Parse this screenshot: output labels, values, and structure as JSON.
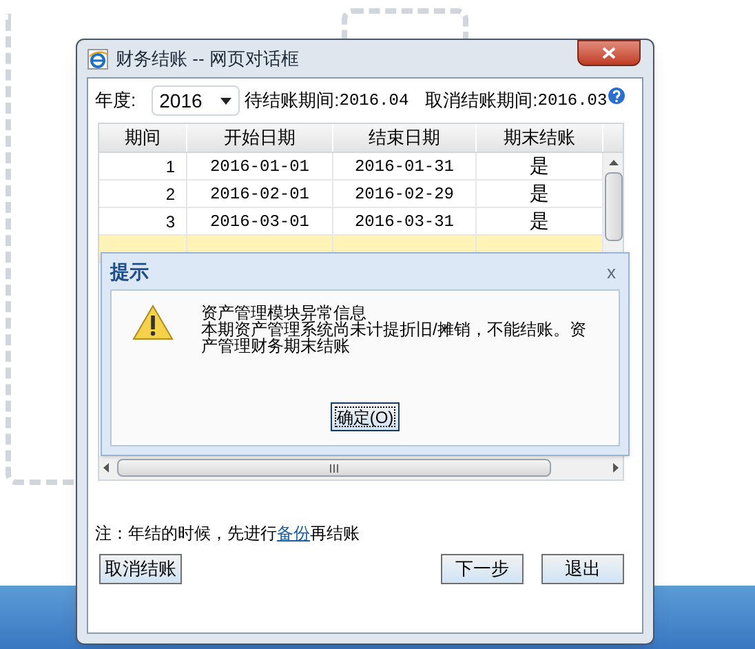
{
  "window": {
    "title": "财务结账 -- 网页对话框"
  },
  "filter": {
    "year_label": "年度:",
    "year": "2016",
    "pending_label": "待结账期间:",
    "pending": "2016.04",
    "cancel_label": "取消结账期间:",
    "cancel": "2016.03"
  },
  "table": {
    "columns": [
      "期间",
      "开始日期",
      "结束日期",
      "期末结账"
    ],
    "rows": [
      {
        "cells": [
          "1",
          "2016-01-01",
          "2016-01-31",
          "是"
        ],
        "selected": false
      },
      {
        "cells": [
          "2",
          "2016-02-01",
          "2016-02-29",
          "是"
        ],
        "selected": false
      },
      {
        "cells": [
          "3",
          "2016-03-01",
          "2016-03-31",
          "是"
        ],
        "selected": false
      },
      {
        "selected": true
      }
    ]
  },
  "note": {
    "before": "注：年结的时候，先进行",
    "link": "备份",
    "after": "再结账"
  },
  "buttons": [
    {
      "label": "取消结账",
      "kind": "left"
    },
    {
      "label": "下一步",
      "kind": "right"
    },
    {
      "label": "退出",
      "kind": "right"
    }
  ],
  "alert": {
    "title": "提示",
    "close": "x",
    "lines": [
      "资产管理模块异常信息",
      "本期资产管理系统尚未计提折旧/摊销，不能结账。资产管理财务期末结账"
    ],
    "button": "确定(O)"
  }
}
